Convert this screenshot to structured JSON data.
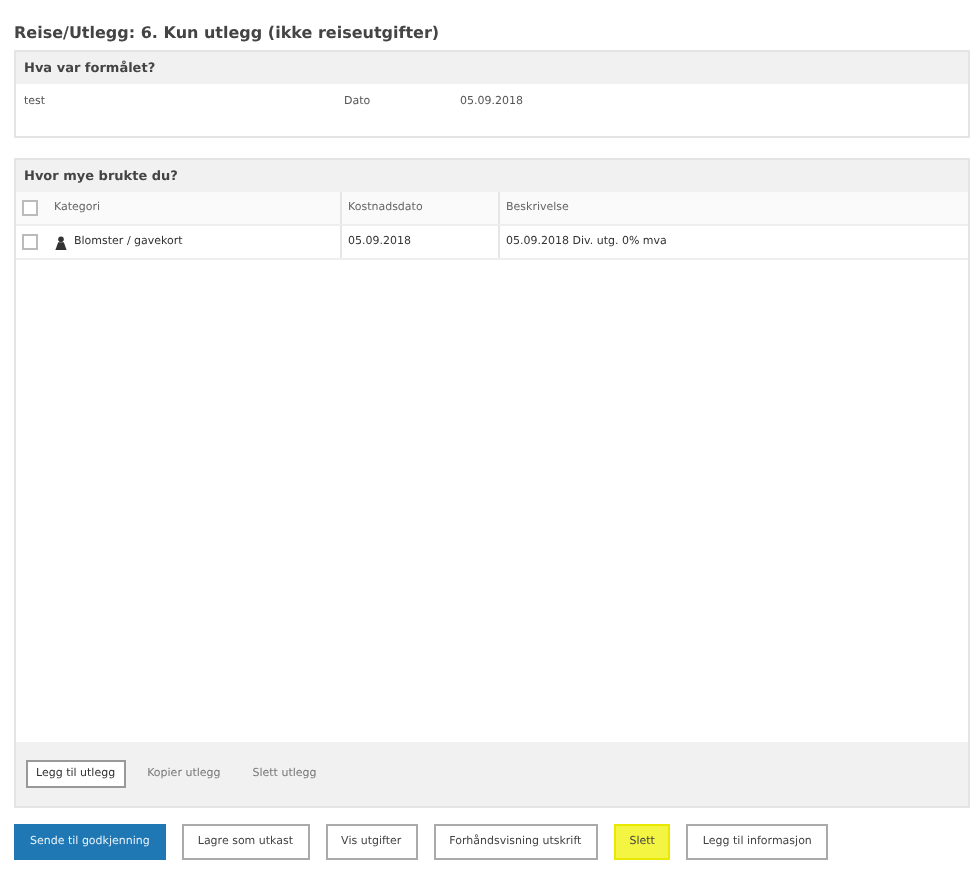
{
  "title": "Reise/Utlegg: 6. Kun utlegg (ikke reiseutgifter)",
  "purpose": {
    "heading": "Hva var formålet?",
    "value": "test",
    "date_label": "Dato",
    "date_value": "05.09.2018"
  },
  "expenses": {
    "heading": "Hvor mye brukte du?",
    "all_checked": false,
    "columns": [
      "Kategori",
      "Kostnadsdato",
      "Beskrivelse"
    ],
    "rows": [
      {
        "checked": false,
        "category": "Blomster / gavekort",
        "date": "05.09.2018",
        "description": "05.09.2018 Div. utg. 0% mva"
      }
    ],
    "actions": [
      {
        "label": "Legg til utlegg",
        "kind": "outlined"
      },
      {
        "label": "Kopier utlegg",
        "kind": "plain"
      },
      {
        "label": "Slett utlegg",
        "kind": "plain"
      }
    ]
  },
  "buttons": [
    {
      "label": "Sende til godkjenning",
      "kind": "primary",
      "highlighted": false
    },
    {
      "label": "Lagre som utkast",
      "kind": "outlined",
      "highlighted": false
    },
    {
      "label": "Vis utgifter",
      "kind": "outlined",
      "highlighted": false
    },
    {
      "label": "Forhåndsvisning utskrift",
      "kind": "outlined",
      "highlighted": false
    },
    {
      "label": "Slett",
      "kind": "outlined",
      "highlighted": true
    },
    {
      "label": "Legg til informasjon",
      "kind": "outlined",
      "highlighted": false
    }
  ]
}
